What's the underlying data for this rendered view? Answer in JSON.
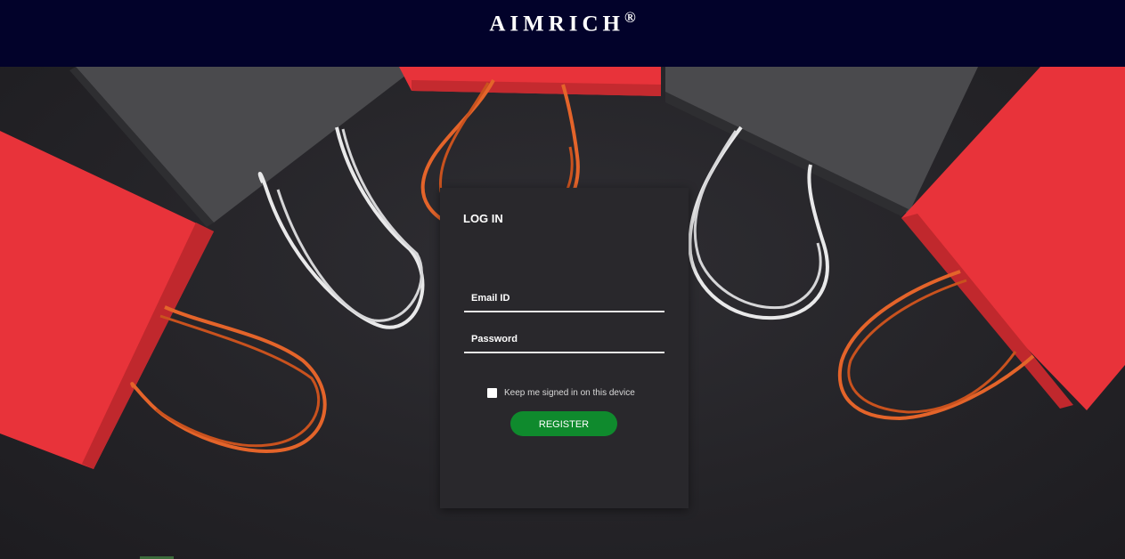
{
  "header": {
    "brand": "AIMRICH",
    "registered_mark": "®"
  },
  "login": {
    "title": "LOG IN",
    "email_placeholder": "Email ID",
    "password_placeholder": "Password",
    "keep_signed_in_label": "Keep me signed in on this device",
    "register_label": "REGISTER"
  },
  "colors": {
    "header_bg": "#02022a",
    "card_bg": "#29282c",
    "button_green": "#0f8a2d",
    "bag_red": "#e8333a",
    "bag_gray": "#4a4a4d",
    "rope_orange": "#e4642a",
    "rope_white": "#e9e9ea"
  },
  "icons": [
    "checkbox-icon"
  ]
}
